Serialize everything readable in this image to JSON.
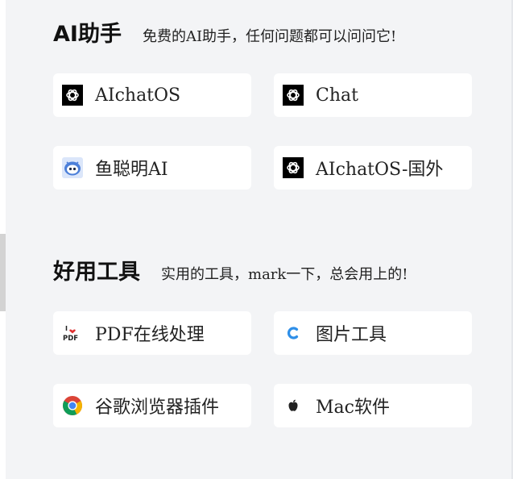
{
  "ai_section": {
    "title": "AI助手",
    "subtitle": "免费的AI助手，任何问题都可以问问它!",
    "items": [
      {
        "label": "AIchatOS",
        "icon": "openai-icon"
      },
      {
        "label": "Chat",
        "icon": "openai-icon"
      },
      {
        "label": "鱼聪明AI",
        "icon": "fish-robot-icon"
      },
      {
        "label": "AIchatOS-国外",
        "icon": "openai-icon"
      }
    ]
  },
  "tools_section": {
    "title": "好用工具",
    "subtitle": "实用的工具，mark一下，总会用上的!",
    "items": [
      {
        "label": "PDF在线处理",
        "icon": "ilovepdf-icon",
        "icon_text": "PDF"
      },
      {
        "label": "图片工具",
        "icon": "image-tool-icon"
      },
      {
        "label": "谷歌浏览器插件",
        "icon": "chrome-icon"
      },
      {
        "label": "Mac软件",
        "icon": "apple-icon"
      }
    ]
  },
  "colors": {
    "background": "#f3f4f6",
    "card": "#ffffff",
    "text": "#222222",
    "openai_bg": "#000000",
    "image_tool_accent": "#2f8fe8",
    "fish_accent": "#4c7fd9"
  }
}
